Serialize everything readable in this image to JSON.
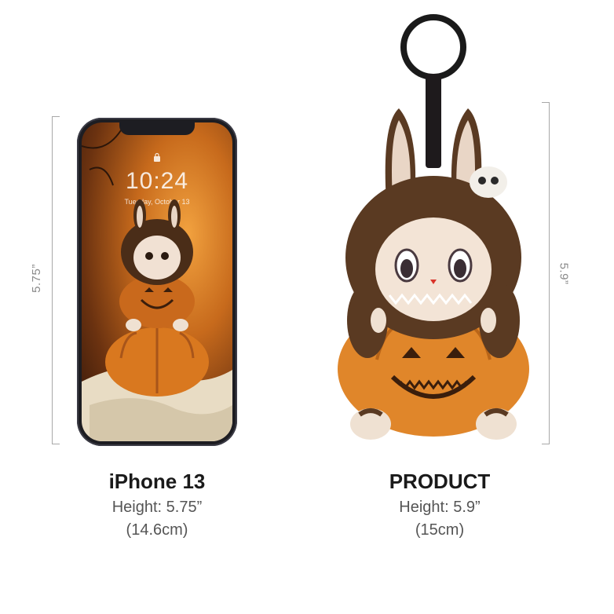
{
  "measurements": {
    "left_dimension": "5.75”",
    "right_dimension": "5.9”"
  },
  "phone_screen": {
    "time": "10:24",
    "date": "Tuesday, October 13"
  },
  "captions": {
    "left": {
      "title": "iPhone 13",
      "height": "Height: 5.75”",
      "metric": "(14.6cm)"
    },
    "right": {
      "title": "PRODUCT",
      "height": "Height: 5.9”",
      "metric": "(15cm)"
    }
  },
  "colors": {
    "fur_brown": "#5a3a22",
    "pumpkin_orange": "#e0862a",
    "ear_inner": "#e9d6c6",
    "ring_black": "#1a1a1a"
  }
}
